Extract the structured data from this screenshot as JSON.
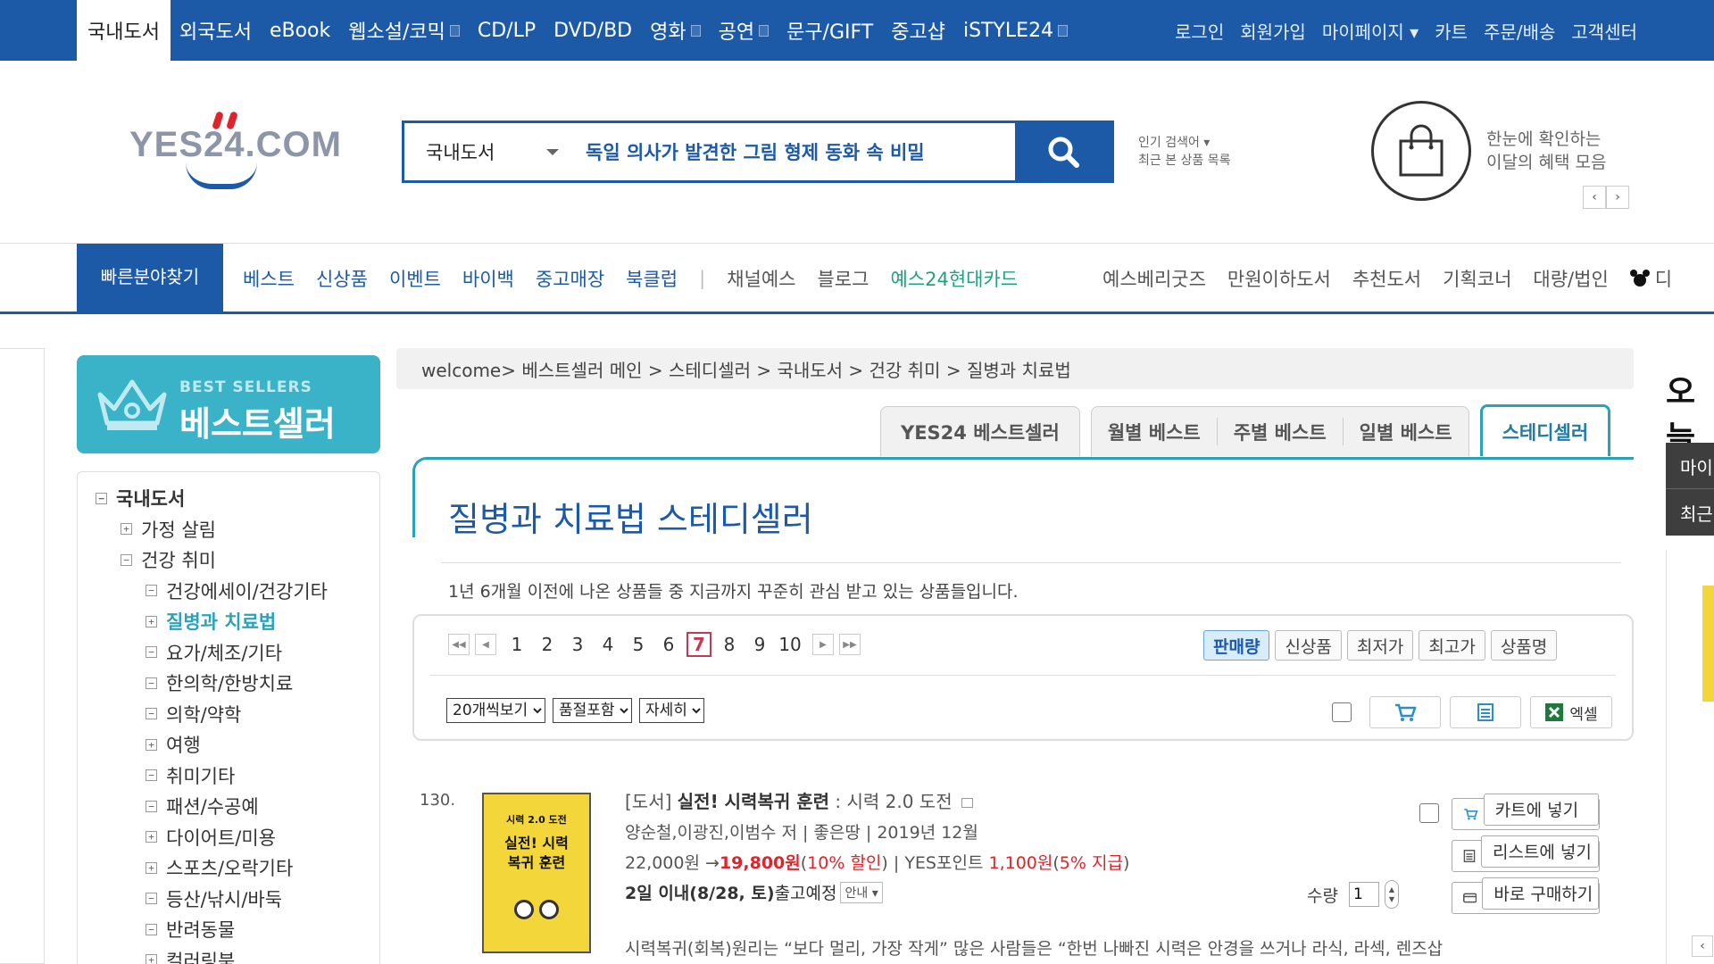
{
  "topnav": {
    "tabs": [
      "국내도서",
      "외국도서",
      "eBook",
      "웹소설/코믹",
      "CD/LP",
      "DVD/BD",
      "영화",
      "공연",
      "문구/GIFT",
      "중고샵",
      "iSTYLE24"
    ],
    "right": [
      "로그인",
      "회원가입",
      "마이페이지 ▾",
      "카트",
      "주문/배송",
      "고객센터"
    ]
  },
  "header": {
    "logo_text": "YES24.COM",
    "search_category": "국내도서",
    "search_value": "독일 의사가 발견한 그림 형제 동화 속 비밀",
    "recent_line1": "인기 검색어 ▾",
    "recent_line2": "최근 본 상품 목록",
    "benefit_line1": "한눈에 확인하는",
    "benefit_line2": "이달의 혜택 모음",
    "benefit_prev": "‹",
    "benefit_next": "›"
  },
  "catbar": {
    "quick": "빠른분야찾기",
    "items": [
      "베스트",
      "신상품",
      "이벤트",
      "바이백",
      "중고매장",
      "북클럽"
    ],
    "sep": "|",
    "items_gray": [
      "채널예스",
      "블로그"
    ],
    "card": "예스24현대카드",
    "right_items": [
      "예스베리굿즈",
      "만원이하도서",
      "추천도서",
      "기획코너",
      "대량/법인",
      "디"
    ]
  },
  "banner": {
    "small": "BEST SELLERS",
    "big": "베스트셀러"
  },
  "tree": [
    {
      "label": "국내도서",
      "level": 0,
      "box": "−"
    },
    {
      "label": "가정 살림",
      "level": 1,
      "box": "+"
    },
    {
      "label": "건강 취미",
      "level": 1,
      "box": "−"
    },
    {
      "label": "건강에세이/건강기타",
      "level": 2,
      "box": "−"
    },
    {
      "label": "질병과 치료법",
      "level": 2,
      "box": "+",
      "active": true
    },
    {
      "label": "요가/체조/기타",
      "level": 2,
      "box": "−"
    },
    {
      "label": "한의학/한방치료",
      "level": 2,
      "box": "−"
    },
    {
      "label": "의학/약학",
      "level": 2,
      "box": "−"
    },
    {
      "label": "여행",
      "level": 2,
      "box": "+"
    },
    {
      "label": "취미기타",
      "level": 2,
      "box": "−"
    },
    {
      "label": "패션/수공예",
      "level": 2,
      "box": "−"
    },
    {
      "label": "다이어트/미용",
      "level": 2,
      "box": "+"
    },
    {
      "label": "스포츠/오락기타",
      "level": 2,
      "box": "+"
    },
    {
      "label": "등산/낚시/바둑",
      "level": 2,
      "box": "−"
    },
    {
      "label": "반려동물",
      "level": 2,
      "box": "−"
    },
    {
      "label": "컬러링북",
      "level": 2,
      "box": "+"
    }
  ],
  "breadcrumb": "welcome> 베스트셀러 메인 > 스테디셀러 > 국내도서 > 건강 취미 > 질병과 치료법",
  "tabs": {
    "yes24": "YES24 베스트셀러",
    "monthly": "월별 베스트",
    "weekly": "주별 베스트",
    "daily": "일별 베스트",
    "steady": "스테디셀러"
  },
  "panel": {
    "title": "질병과 치료법 스테디셀러",
    "desc": "1년 6개월 이전에 나온 상품들 중 지금까지 꾸준히 관심 받고 있는 상품들입니다."
  },
  "pager": {
    "pages": [
      "1",
      "2",
      "3",
      "4",
      "5",
      "6",
      "7",
      "8",
      "9",
      "10"
    ],
    "current": "7"
  },
  "sort": [
    "판매량",
    "신상품",
    "최저가",
    "최고가",
    "상품명"
  ],
  "selects": {
    "per_page": "20개씩보기",
    "stock": "품절포함",
    "view": "자세히"
  },
  "excel_label": "엑셀",
  "product": {
    "rank": "130.",
    "cover_text_top": "시력 2.0 도전",
    "cover_title": "실전! 시력복귀 훈련",
    "prefix": "[도서]",
    "title": "실전! 시력복귀 훈련",
    "subtitle": " : 시력 2.0 도전",
    "authors": "양순철,이광진,이범수 저",
    "publisher": "좋은땅",
    "date": "2019년 12월",
    "price": "22,000원",
    "sale_price": "19,800원",
    "discount": "10% 할인",
    "points_label": "YES포인트",
    "points": "1,100원",
    "points_pct": "5% 지급",
    "ship_bold": "2일 이내(8/28, 토)",
    "ship_rest": " 출고예정",
    "guide": "안내 ▾",
    "qty_label": "수량",
    "qty_value": "1",
    "cart_btn": "카트에 넣기",
    "list_btn": "리스트에 넣기",
    "buy_btn": "바로 구매하기",
    "desc": "시력복귀(회복)원리는 “보다 멀리, 가장 작게” 많은 사람들은 “한번 나빠진 시력은 안경을 쓰거나 라식, 라섹, 렌즈삽"
  },
  "right": {
    "cut_title": "오늘",
    "bar1": "마이",
    "bar2": "최근"
  }
}
